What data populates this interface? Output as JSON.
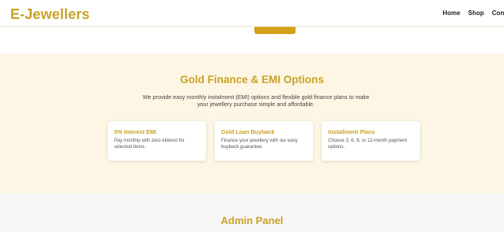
{
  "header": {
    "logo": "E-Jewellers",
    "nav": [
      "Home",
      "Shop",
      "Cont"
    ]
  },
  "finance": {
    "title": "Gold Finance & EMI Options",
    "description": "We provide easy monthly instalment (EMI) options and flexible gold finance plans to make your jewellery purchase simple and affordable.",
    "cards": [
      {
        "title": "0% Interest EMI",
        "text": "Pay monthly with zero interest for selected items."
      },
      {
        "title": "Gold Loan Buyback",
        "text": "Finance your jewellery with our easy buyback guarantee."
      },
      {
        "title": "Installment Plans",
        "text": "Choose 3, 6, 9, or 12-month payment options."
      }
    ]
  },
  "admin": {
    "title": "Admin Panel"
  },
  "colors": {
    "brand": "#c9a227",
    "finance_bg": "#fdf6e4",
    "admin_bg": "#f7f7f7"
  }
}
